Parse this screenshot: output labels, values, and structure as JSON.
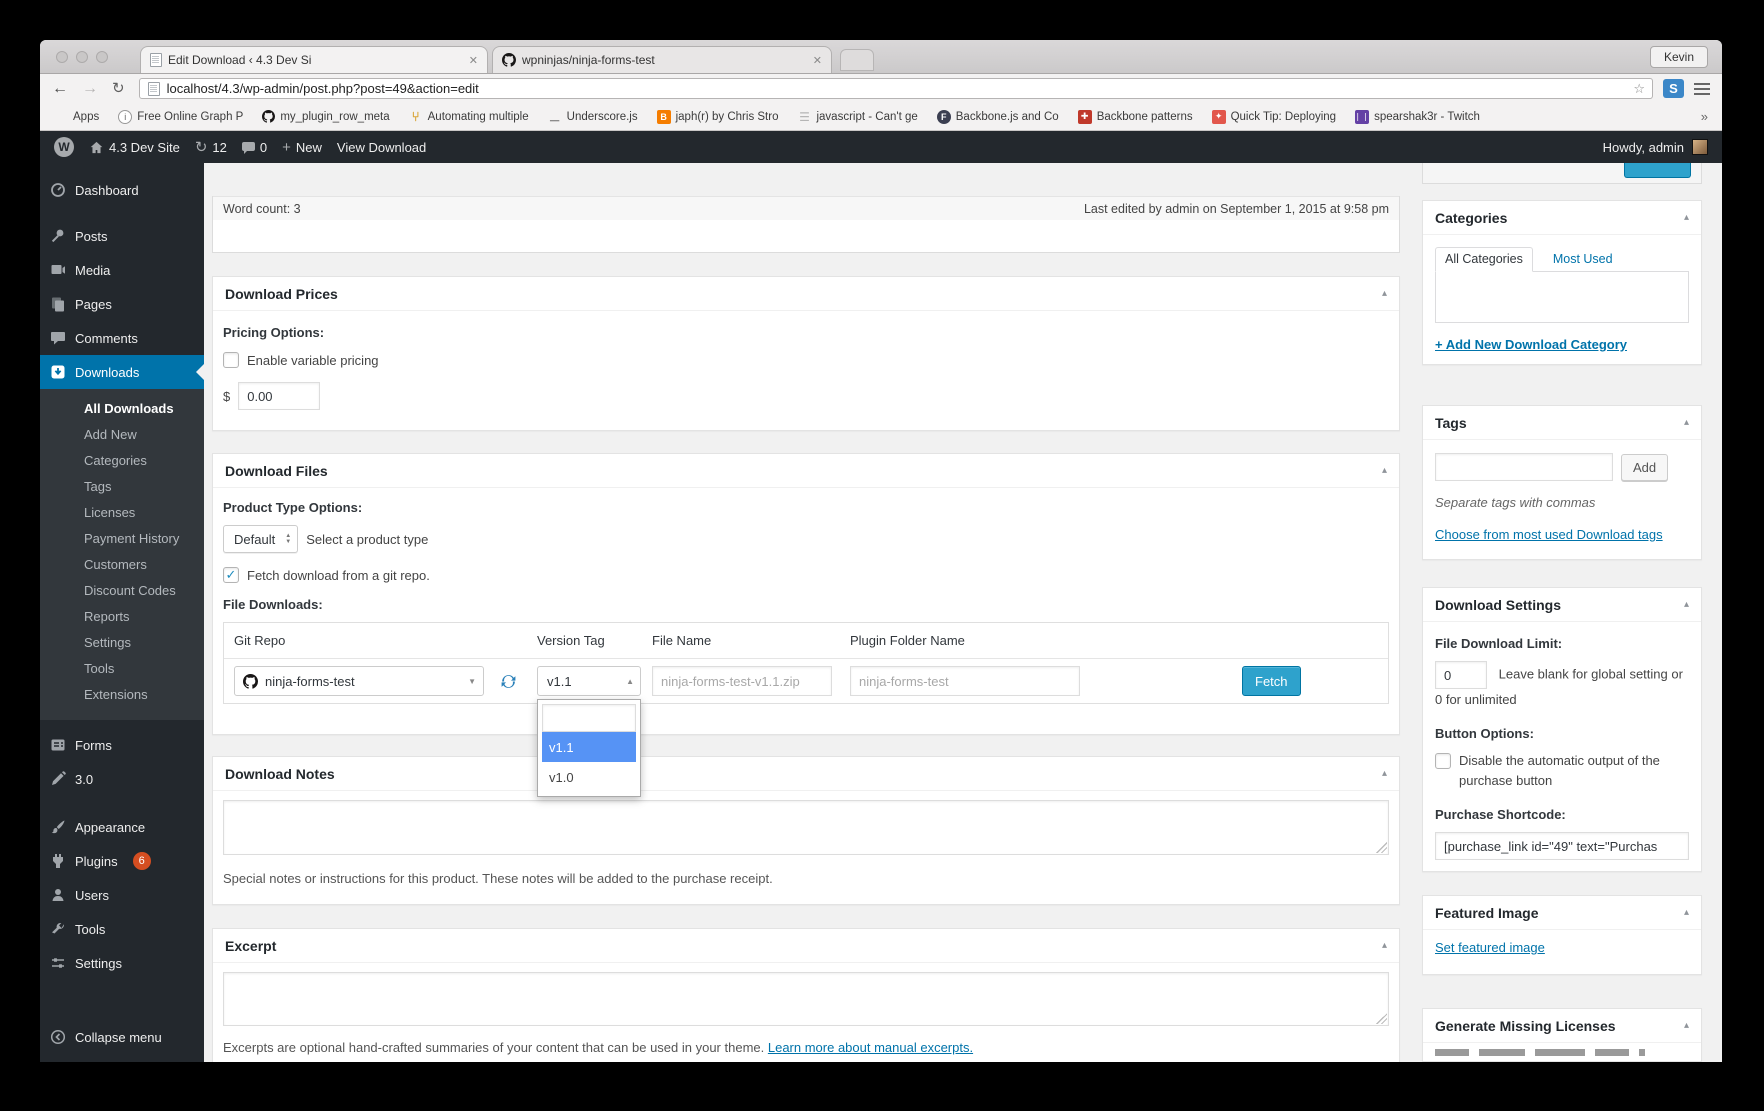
{
  "browser": {
    "tabs": [
      {
        "label": "Edit Download ‹ 4.3 Dev Si"
      },
      {
        "label": "wpninjas/ninja-forms-test"
      }
    ],
    "profile_name": "Kevin",
    "url": "localhost/4.3/wp-admin/post.php?post=49&action=edit",
    "bookmarks": [
      "Apps",
      "Free Online Graph P",
      "my_plugin_row_meta",
      "Automating multiple",
      "Underscore.js",
      "japh(r) by Chris Stro",
      "javascript - Can't ge",
      "Backbone.js and Co",
      "Backbone patterns",
      "Quick Tip: Deploying",
      "spearshak3r - Twitch"
    ],
    "bookmarks_overflow": "»"
  },
  "adminbar": {
    "site_name": "4.3 Dev Site",
    "updates_count": "12",
    "comments_count": "0",
    "new_label": "New",
    "view_label": "View Download",
    "howdy": "Howdy, admin"
  },
  "menu": {
    "top": [
      "Dashboard",
      "Posts",
      "Media",
      "Pages",
      "Comments",
      "Downloads"
    ],
    "submenu": [
      "All Downloads",
      "Add New",
      "Categories",
      "Tags",
      "Licenses",
      "Payment History",
      "Customers",
      "Discount Codes",
      "Reports",
      "Settings",
      "Tools",
      "Extensions"
    ],
    "lower": [
      "Forms",
      "3.0",
      "Appearance",
      "Plugins",
      "Users",
      "Tools",
      "Settings"
    ],
    "plugins_badge": "6",
    "collapse_label": "Collapse menu"
  },
  "main": {
    "editor": {
      "word_count": "Word count: 3",
      "last_edited": "Last edited by admin on September 1, 2015 at 9:58 pm"
    },
    "prices": {
      "title": "Download Prices",
      "options_label": "Pricing Options:",
      "variable_label": "Enable variable pricing",
      "currency": "$",
      "amount": "0.00"
    },
    "files": {
      "title": "Download Files",
      "type_label": "Product Type Options:",
      "type_value": "Default",
      "type_hint": "Select a product type",
      "git_label": "Fetch download from a git repo.",
      "downloads_label": "File Downloads:",
      "columns": [
        "Git Repo",
        "Version Tag",
        "File Name",
        "Plugin Folder Name"
      ],
      "repo": "ninja-forms-test",
      "version": "v1.1",
      "file_placeholder": "ninja-forms-test-v1.1.zip",
      "folder_placeholder": "ninja-forms-test",
      "fetch_label": "Fetch",
      "options": [
        "v1.1",
        "v1.0"
      ]
    },
    "notes": {
      "title": "Download Notes",
      "hint": "Special notes or instructions for this product. These notes will be added to the purchase receipt."
    },
    "excerpt": {
      "title": "Excerpt",
      "hint": "Excerpts are optional hand-crafted summaries of your content that can be used in your theme. ",
      "link": "Learn more about manual excerpts."
    }
  },
  "side": {
    "categories": {
      "title": "Categories",
      "tab_all": "All Categories",
      "tab_most": "Most Used",
      "add_link": "+ Add New Download Category"
    },
    "tags": {
      "title": "Tags",
      "add_label": "Add",
      "hint": "Separate tags with commas",
      "choose_link": "Choose from most used Download tags"
    },
    "settings": {
      "title": "Download Settings",
      "limit_label": "File Download Limit:",
      "limit_value": "0",
      "limit_hint": "Leave blank for global setting or 0 for unlimited",
      "button_label": "Button Options:",
      "disable_label": "Disable the automatic output of the purchase button",
      "shortcode_label": "Purchase Shortcode:",
      "shortcode_value": "[purchase_link id=\"49\" text=\"Purchas"
    },
    "featured": {
      "title": "Featured Image",
      "set_link": "Set featured image"
    },
    "licenses": {
      "title": "Generate Missing Licenses"
    }
  },
  "colors": {
    "accent": "#0073aa",
    "button_primary": "#2ea2cc",
    "select_highlight": "#5693f5",
    "badge": "#d54e21",
    "admin_dark": "#23282d"
  }
}
